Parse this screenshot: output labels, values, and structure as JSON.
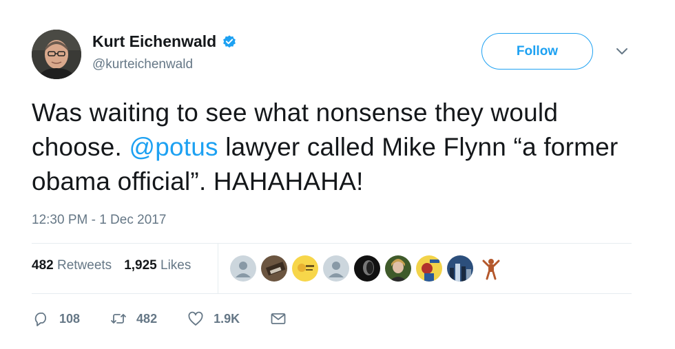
{
  "user": {
    "display_name": "Kurt Eichenwald",
    "handle": "@kurteichenwald",
    "verified": true
  },
  "follow_button": {
    "label": "Follow"
  },
  "tweet": {
    "text_before": "Was waiting to see what nonsense they would choose. ",
    "mention": "@potus",
    "text_after": " lawyer called Mike Flynn “a former obama official”. HAHAHAHA!",
    "timestamp": "12:30 PM - 1 Dec 2017"
  },
  "stats": {
    "retweets_count": "482",
    "retweets_label": "Retweets",
    "likes_count": "1,925",
    "likes_label": "Likes"
  },
  "actions": {
    "reply_count": "108",
    "retweet_count": "482",
    "like_count": "1.9K"
  },
  "liker_avatars": [
    "default-avatar",
    "photo-avatar",
    "yellow-avatar",
    "default-avatar",
    "dark-avatar",
    "portrait-avatar",
    "illustration-avatar",
    "city-avatar",
    "figure-avatar"
  ],
  "colors": {
    "accent": "#1da1f2",
    "text": "#14171a",
    "secondary_text": "#657786",
    "divider": "#e6ecf0"
  }
}
